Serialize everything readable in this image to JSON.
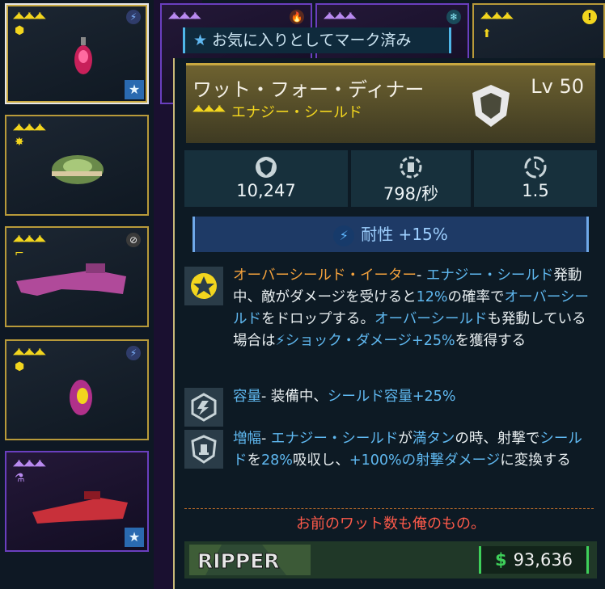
{
  "inventory": {
    "slots": [
      {
        "element": "shock",
        "favorite": true
      },
      {
        "element": "fire"
      },
      {
        "element": "cryo"
      },
      {
        "alert": "!"
      },
      {},
      {
        "equipped_badge": "✔"
      },
      {
        "element": "shock"
      },
      {
        "favorite": true
      }
    ]
  },
  "tooltip": {
    "favorite_label": "お気に入りとしてマーク済み",
    "name": "ワット・フォー・ディナー",
    "level": "Lv 50",
    "type": "エナジー・シールド",
    "stats": [
      {
        "icon": "shield-capacity-icon",
        "value": "10,247"
      },
      {
        "icon": "recharge-rate-icon",
        "value": "798/秒"
      },
      {
        "icon": "recharge-delay-icon",
        "value": "1.5"
      }
    ],
    "resistance": "耐性 +15%",
    "perks": [
      {
        "icon": "overshield-eater-icon",
        "parts": [
          {
            "c": "o",
            "t": "オーバーシールド・イーター"
          },
          {
            "c": "",
            "t": "- "
          },
          {
            "c": "b",
            "t": "エナジー・シールド"
          },
          {
            "c": "",
            "t": "発動中、敵がダメージを受けると"
          },
          {
            "c": "b",
            "t": "12%"
          },
          {
            "c": "",
            "t": "の確率で"
          },
          {
            "c": "b",
            "t": "オーバーシールド"
          },
          {
            "c": "",
            "t": "をドロップする。"
          },
          {
            "c": "b",
            "t": "オーバーシールド"
          },
          {
            "c": "",
            "t": "も発動している場合は"
          },
          {
            "c": "b",
            "t": "⚡ショック・ダメージ+25%"
          },
          {
            "c": "",
            "t": "を獲得する"
          }
        ]
      },
      {
        "icon": "capacity-icon",
        "parts": [
          {
            "c": "b",
            "t": "容量"
          },
          {
            "c": "",
            "t": "- 装備中、"
          },
          {
            "c": "b",
            "t": "シールド容量+25%"
          }
        ]
      },
      {
        "icon": "amp-icon",
        "parts": [
          {
            "c": "b",
            "t": "増幅"
          },
          {
            "c": "",
            "t": "- "
          },
          {
            "c": "b",
            "t": "エナジー・シールド"
          },
          {
            "c": "",
            "t": "が"
          },
          {
            "c": "b",
            "t": "満タン"
          },
          {
            "c": "",
            "t": "の時、射撃で"
          },
          {
            "c": "b",
            "t": "シールド"
          },
          {
            "c": "",
            "t": "を"
          },
          {
            "c": "b",
            "t": "28%"
          },
          {
            "c": "",
            "t": "吸収し、"
          },
          {
            "c": "b",
            "t": "+100%の射撃ダメージ"
          },
          {
            "c": "",
            "t": "に変換する"
          }
        ]
      }
    ],
    "flavor": "お前のワット数も俺のもの。",
    "manufacturer": "RIPPER",
    "price_symbol": "$",
    "price": "93,636"
  },
  "colors": {
    "legendary": "#f2d51e",
    "epic": "#b98af0",
    "highlight": "#5fb8f0",
    "perk_name": "#f5a23c",
    "flavor": "#ff5a4a",
    "money": "#3ed05a"
  }
}
